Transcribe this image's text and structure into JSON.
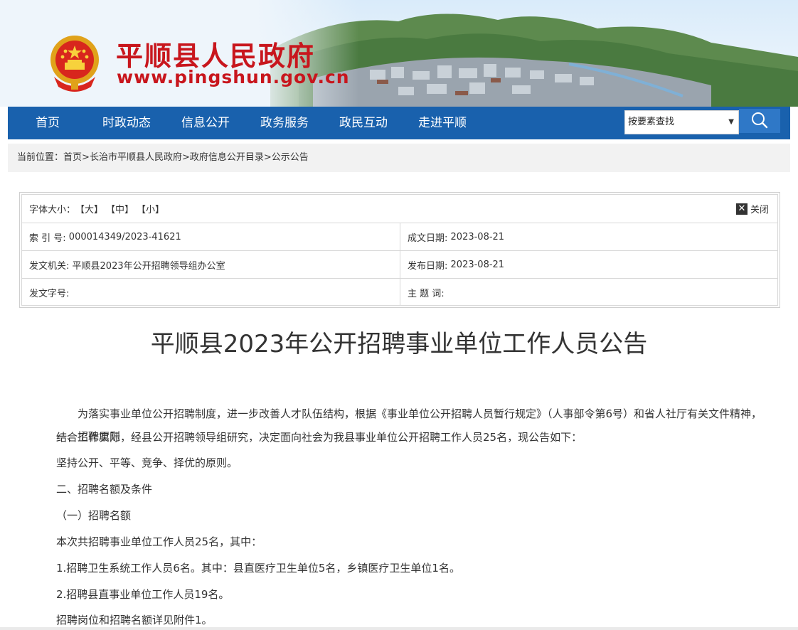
{
  "header": {
    "site_title": "平顺县人民政府",
    "site_url": "www.pingshun.gov.cn"
  },
  "nav": {
    "items": [
      "首页",
      "时政动态",
      "信息公开",
      "政务服务",
      "政民互动",
      "走进平顺"
    ],
    "search_select_value": "按要素查找"
  },
  "breadcrumb": {
    "prefix": "当前位置：",
    "items": [
      "首页",
      "长治市平顺县人民政府",
      "政府信息公开目录",
      "公示公告"
    ],
    "separator": ">"
  },
  "info": {
    "font_size_label": "字体大小：",
    "font_large": "【大】",
    "font_medium": "【中】",
    "font_small": "【小】",
    "close_label": "关闭",
    "index_label": "索 引 号:",
    "index_value": "000014349/2023-41621",
    "written_date_label": "成文日期:",
    "written_date_value": "2023-08-21",
    "issuer_label": "发文机关:",
    "issuer_value": "平顺县2023年公开招聘领导组办公室",
    "publish_date_label": "发布日期:",
    "publish_date_value": "2023-08-21",
    "doc_no_label": "发文字号:",
    "doc_no_value": "",
    "subject_label": "主 题 词:",
    "subject_value": ""
  },
  "article": {
    "title": "平顺县2023年公开招聘事业单位工作人员公告",
    "intro": "为落实事业单位公开招聘制度，进一步改善人才队伍结构，根据《事业单位公开招聘人员暂行规定》（人事部令第6号）和省人社厅有关文件精神，结合工作实际，经县公开招聘领导组研究，决定面向社会为我县事业单位公开招聘工作人员25名，现公告如下：",
    "paragraphs": [
      "一、招聘原则",
      "坚持公开、平等、竞争、择优的原则。",
      "二、招聘名额及条件",
      "（一）招聘名额",
      "本次共招聘事业单位工作人员25名，其中：",
      "1.招聘卫生系统工作人员6名。其中：县直医疗卫生单位5名，乡镇医疗卫生单位1名。",
      "2.招聘县直事业单位工作人员19名。",
      "招聘岗位和招聘名额详见附件1。"
    ]
  },
  "colors": {
    "brand_red": "#c8161d",
    "nav_blue": "#1961ad",
    "search_blue": "#2f78c7"
  }
}
